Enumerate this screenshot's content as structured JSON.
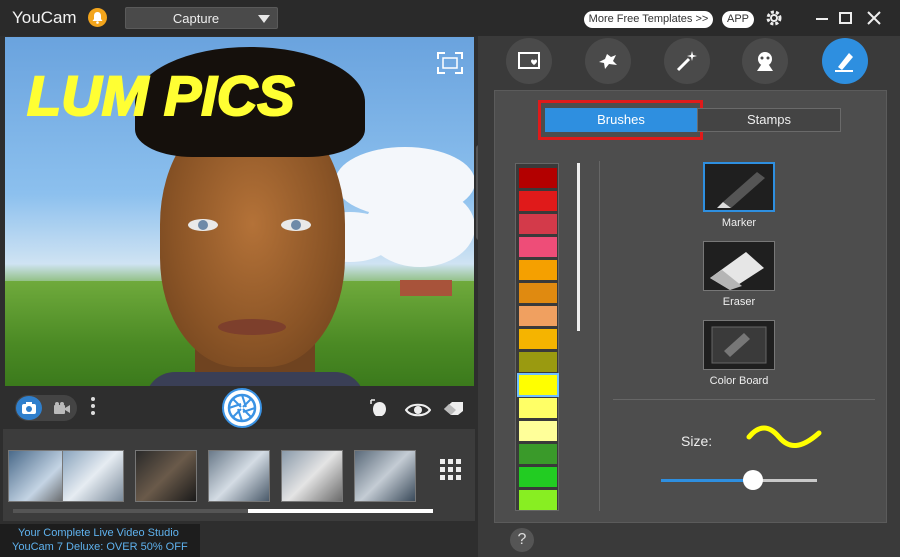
{
  "app": {
    "title": "YouCam",
    "mode": "Capture"
  },
  "preview": {
    "overlay_text": "LUM PICS",
    "overlay_color": "#ffff33"
  },
  "header": {
    "templates_label": "More Free Templates >>",
    "app_label": "APP"
  },
  "effects": {
    "categories": [
      "frame-icon",
      "particle-icon",
      "magic-wand-icon",
      "avatar-icon",
      "brush-pen-icon"
    ],
    "active": "brush-pen-icon",
    "accent": "#2e8fe0"
  },
  "brush_panel": {
    "tabs": [
      {
        "label": "Brushes",
        "active": true
      },
      {
        "label": "Stamps",
        "active": false
      }
    ],
    "palette": [
      "#b30000",
      "#e01a1a",
      "#d33a4a",
      "#ee4d78",
      "#f5a000",
      "#e08a10",
      "#f0a060",
      "#f5b400",
      "#9a9a10",
      "#ffff00",
      "#ffff66",
      "#ffff99",
      "#3a9a2a",
      "#22cc22",
      "#88ee22"
    ],
    "selected_swatch": 9,
    "tools": [
      {
        "label": "Marker",
        "active": true
      },
      {
        "label": "Eraser",
        "active": false
      },
      {
        "label": "Color Board",
        "active": false
      }
    ],
    "size_label": "Size:",
    "size_fraction": 0.59
  },
  "promo": {
    "line1": "Your Complete Live Video Studio",
    "line2": "YouCam 7 Deluxe: OVER 50% OFF"
  },
  "help": "?"
}
